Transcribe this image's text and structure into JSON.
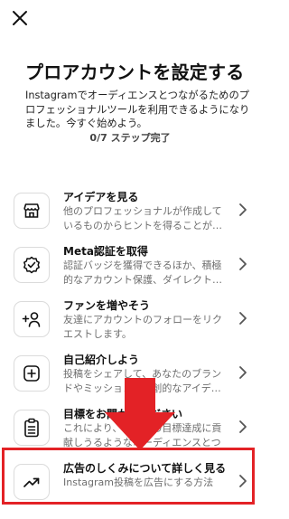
{
  "header": {
    "close_icon": "close-icon"
  },
  "title": "プロアカウントを設定する",
  "subtitle": "Instagramでオーディエンスとつながるためのプロフェッショナルツールを利用できるようになりました。今すぐ始めよう。",
  "progress": "0/7 ステップ完了",
  "items": [
    {
      "title": "アイデアを見る",
      "desc": "他のプロフェッショナルが作成しているものからヒントを得ることが…",
      "icon": "store-icon"
    },
    {
      "title": "Meta認証を取得",
      "desc": "認証バッジを獲得できるほか、積極的なアカウント保護、ダイレクト…",
      "icon": "verified-badge-icon"
    },
    {
      "title": "ファンを増やそう",
      "desc": "友達にアカウントのフォローをリクエストします。",
      "icon": "add-person-icon"
    },
    {
      "title": "自己紹介しよう",
      "desc": "投稿をシェアして、あなたのブランドやミッション、独創的なアイデ…",
      "icon": "plus-square-icon"
    },
    {
      "title": "目標をお聞かせください",
      "desc": "これにより、あなたの目標達成に貢献しうるようなオーディエンスとつな…",
      "icon": "clipboard-icon"
    },
    {
      "title": "広告のしくみについて詳しく見る",
      "desc": "Instagram投稿を広告にする方法",
      "icon": "trending-up-icon"
    }
  ],
  "colors": {
    "highlight": "#e32226",
    "arrow": "#e32226"
  }
}
